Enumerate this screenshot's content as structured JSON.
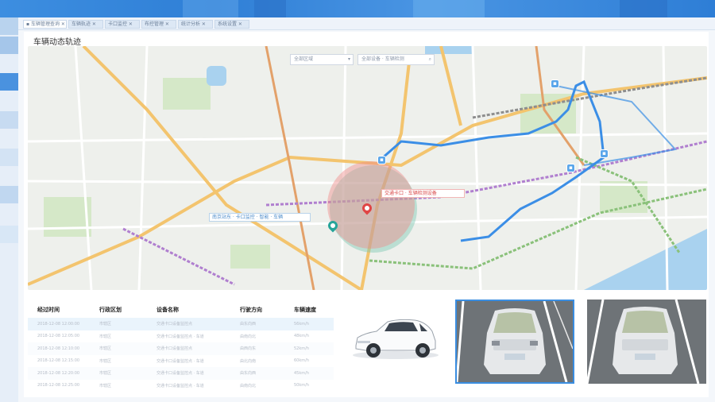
{
  "tabs": [
    {
      "label": "▪ 车辆管理查询 ✕",
      "active": true
    },
    {
      "label": "车辆轨迹 ✕",
      "active": false
    },
    {
      "label": "卡口监控 ✕",
      "active": false
    },
    {
      "label": "布控管理 ✕",
      "active": false
    },
    {
      "label": "统计分析 ✕",
      "active": false
    },
    {
      "label": "系统设置 ✕",
      "active": false
    }
  ],
  "panel": {
    "title": "车辆动态轨迹"
  },
  "map": {
    "select_region": "全部区域",
    "select_device": "全部设备 · 车辆检测",
    "callout_left": "南京站东 · 卡口监控 · 智能 · 车辆",
    "callout_right": "交通卡口 · 车辆检测设备",
    "colors": {
      "track": "#3b8ee6",
      "circle_red": "#f08b8b",
      "circle_green": "#7cc7b4"
    }
  },
  "table": {
    "headers": [
      "经过时间",
      "行政区划",
      "设备名称",
      "行驶方向",
      "车辆速度"
    ],
    "rows": [
      [
        "2018-12-08 12:00:00",
        "市辖区",
        "交通卡口设备监控点",
        "由东向西",
        "56km/h"
      ],
      [
        "2018-12-08 12:05:00",
        "市辖区",
        "交通卡口设备监控点 · 车道",
        "由南向北",
        "48km/h"
      ],
      [
        "2018-12-08 12:10:00",
        "市辖区",
        "交通卡口设备监控点",
        "由西向东",
        "52km/h"
      ],
      [
        "2018-12-08 12:15:00",
        "市辖区",
        "交通卡口设备监控点 · 车道",
        "由北向南",
        "60km/h"
      ],
      [
        "2018-12-08 12:20:00",
        "市辖区",
        "交通卡口设备监控点 · 车道",
        "由东向西",
        "45km/h"
      ],
      [
        "2018-12-08 12:25:00",
        "市辖区",
        "交通卡口设备监控点 · 车道",
        "由南向北",
        "50km/h"
      ]
    ]
  },
  "icons": {
    "car": "car-icon",
    "camera": "camera-icon",
    "pin": "map-pin-icon"
  }
}
